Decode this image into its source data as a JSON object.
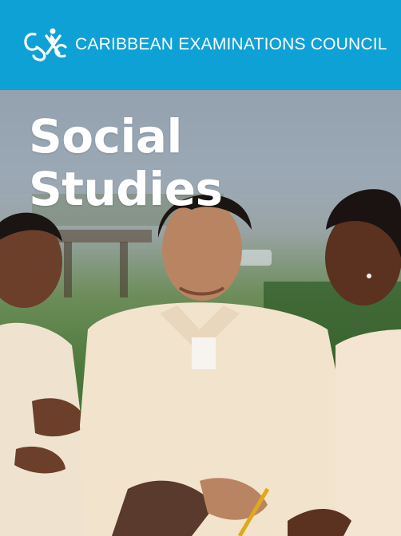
{
  "header": {
    "organization": "CARIBBEAN EXAMINATIONS COUNCIL",
    "logo_letters": "CXC",
    "background": "#0ea1d6"
  },
  "cover": {
    "title_line1": "Social",
    "title_line2": "Studies"
  },
  "photo": {
    "description_icon": "students-talking-photo"
  }
}
